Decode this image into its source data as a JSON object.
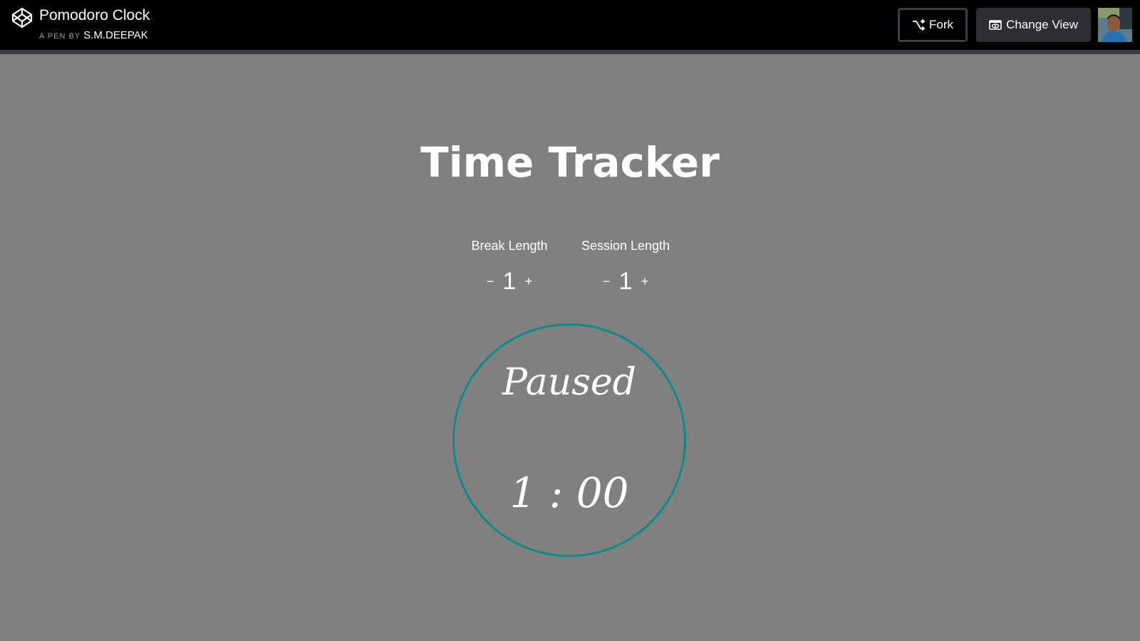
{
  "header": {
    "pen_title": "Pomodoro Clock",
    "author_prefix": "A PEN BY",
    "author_name": "S.M.DEEPAK",
    "fork_label": "Fork",
    "change_view_label": "Change View",
    "logo_icon": "codepen-logo-icon",
    "fork_icon": "fork-icon",
    "view_icon": "eye-icon"
  },
  "main": {
    "title": "Time Tracker",
    "break": {
      "label": "Break Length",
      "decrement": "−",
      "value": "1",
      "increment": "+"
    },
    "session": {
      "label": "Session Length",
      "decrement": "−",
      "value": "1",
      "increment": "+"
    },
    "clock": {
      "status": "Paused",
      "time": "1 : 00",
      "ring_color": "#0f8a8a"
    }
  },
  "colors": {
    "page_background": "#808080",
    "topbar_background": "#000000",
    "text": "#ffffff"
  }
}
